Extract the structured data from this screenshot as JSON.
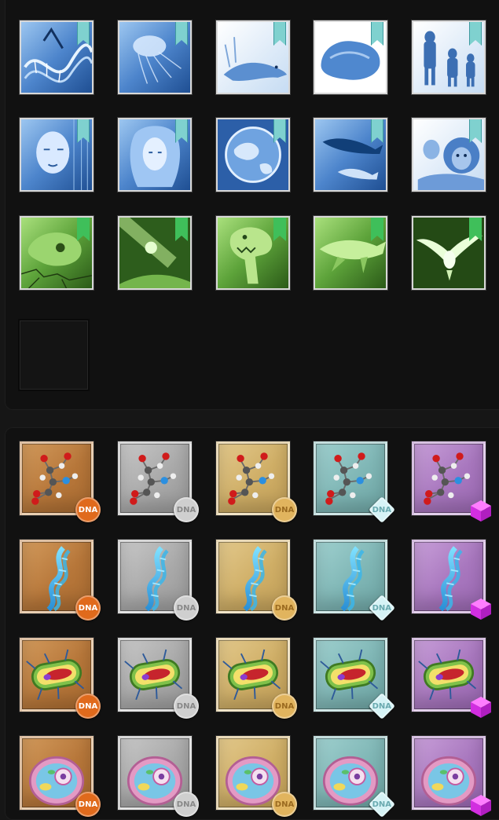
{
  "unlocked_section": {
    "rows": [
      [
        {
          "name": "dna-strand-card",
          "theme": "blue"
        },
        {
          "name": "jellyfish-card",
          "theme": "blue"
        },
        {
          "name": "amphibian-card",
          "theme": "blue"
        },
        {
          "name": "rock-card",
          "theme": "blue"
        },
        {
          "name": "early-humans-card",
          "theme": "blue"
        }
      ],
      [
        {
          "name": "digital-face-card",
          "theme": "blue"
        },
        {
          "name": "cyber-woman-card",
          "theme": "blue"
        },
        {
          "name": "earth-globe-card",
          "theme": "blue"
        },
        {
          "name": "whales-card",
          "theme": "blue"
        },
        {
          "name": "lions-card",
          "theme": "blue"
        }
      ],
      [
        {
          "name": "dinosaur-skull-card",
          "theme": "green"
        },
        {
          "name": "comet-card",
          "theme": "green"
        },
        {
          "name": "t-rex-card",
          "theme": "green"
        },
        {
          "name": "sea-reptile-card",
          "theme": "green"
        },
        {
          "name": "bird-card",
          "theme": "green"
        }
      ]
    ],
    "empty_slots": 1
  },
  "rarity_section": {
    "tiers": [
      "bronze",
      "silver",
      "gold",
      "teal",
      "purple"
    ],
    "items": [
      "molecule",
      "dna",
      "bacterium",
      "cell"
    ],
    "badge_label": "DNA"
  },
  "colors": {
    "bronze": "#e06a1c",
    "silver": "#cfcfcf",
    "gold": "#e1b45e",
    "teal": "#d6f3f6",
    "purple": "#e23ff0",
    "ribbon_blue": "#7fd1cf",
    "ribbon_green": "#3fbf5a"
  }
}
